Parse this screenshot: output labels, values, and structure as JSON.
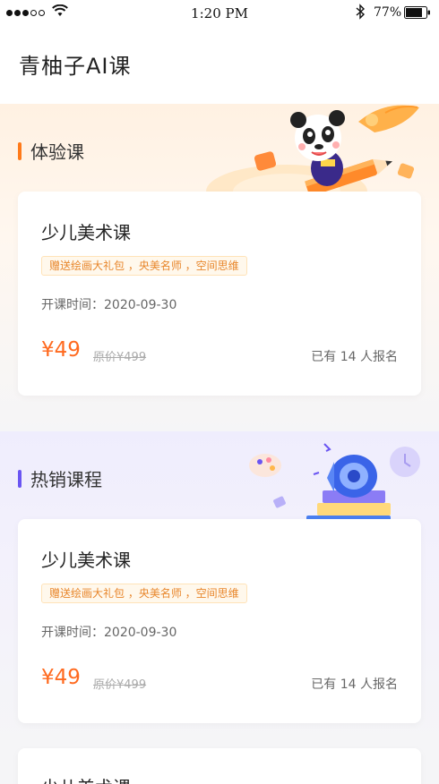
{
  "status_bar": {
    "time": "1:20 PM",
    "battery": "77%"
  },
  "header": {
    "title": "青柚子AI课"
  },
  "sections": [
    {
      "title": "体验课",
      "accent": "#ff7a1a",
      "card": {
        "title": "少儿美术课",
        "tags": "赠送绘画大礼包 ，央美名师 ，空间思维",
        "date": "开课时间：2020-09-30",
        "price": "¥49",
        "original_price": "原价¥499",
        "enrolled": "已有 14 人报名"
      }
    },
    {
      "title": "热销课程",
      "accent": "#6a55f2",
      "card": {
        "title": "少儿美术课",
        "tags": "赠送绘画大礼包 ，央美名师 ，空间思维",
        "date": "开课时间：2020-09-30",
        "price": "¥49",
        "original_price": "原价¥499",
        "enrolled": "已有 14 人报名"
      }
    },
    {
      "card": {
        "title": "少儿美术课"
      }
    }
  ],
  "colors": {
    "price": "#ff6a1a",
    "tag_text": "#e8862b",
    "tag_bg": "#fff8ec"
  }
}
